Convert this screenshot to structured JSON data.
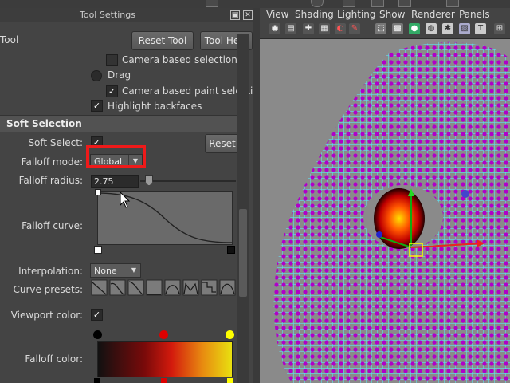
{
  "panel": {
    "title": "Tool Settings",
    "header_label": "Tool",
    "reset_tool": "Reset Tool",
    "tool_help": "Tool Help",
    "camera_based_selection": "Camera based selection",
    "drag": "Drag",
    "camera_based_paint_selection": "Camera based paint selection",
    "highlight_backfaces": "Highlight backfaces"
  },
  "soft_selection": {
    "section_title": "Soft Selection",
    "soft_select_label": "Soft Select:",
    "soft_select_checked": "✓",
    "reset_label": "Reset",
    "falloff_mode_label": "Falloff mode:",
    "falloff_mode_value": "Global",
    "falloff_radius_label": "Falloff radius:",
    "falloff_radius_value": "2.75",
    "falloff_curve_label": "Falloff curve:",
    "interpolation_label": "Interpolation:",
    "interpolation_value": "None",
    "curve_presets_label": "Curve presets:",
    "viewport_color_label": "Viewport color:",
    "falloff_color_label": "Falloff color:"
  },
  "viewport": {
    "menus": [
      "View",
      "Shading",
      "Lighting",
      "Show",
      "Renderer",
      "Panels"
    ]
  },
  "colors": {
    "highlight": "#ef1a1a",
    "mesh_magenta": "#b000c8",
    "mesh_cyan": "#5fe0f0"
  },
  "icons": {
    "arrow": "dropdown-arrow-icon",
    "check": "checkmark-icon"
  }
}
